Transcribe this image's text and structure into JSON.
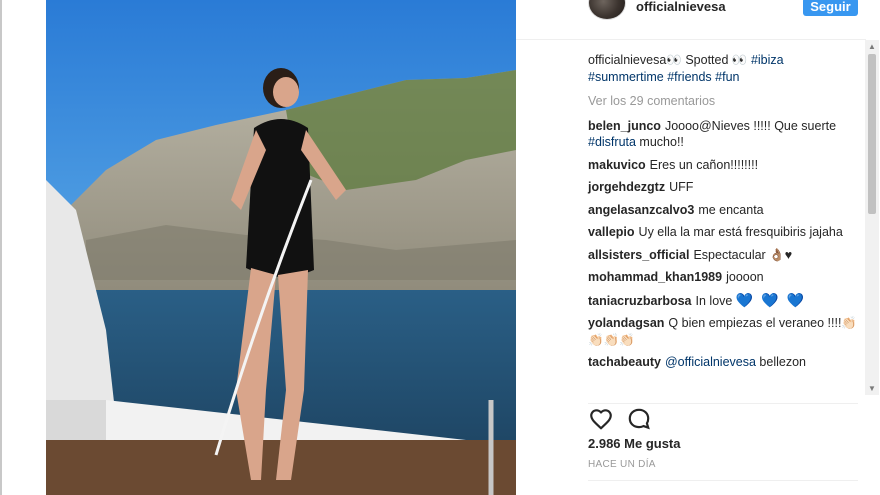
{
  "post": {
    "username": "officialnievesa",
    "follow_label": "Seguir"
  },
  "caption": {
    "user": "officialnievesa",
    "text_before": "👀 Spotted 👀 ",
    "tag1": "#ibiza",
    "tag2": "#summertime",
    "tag3": "#friends",
    "tag4": "#fun"
  },
  "view_all": "Ver los 29 comentarios",
  "comments": [
    {
      "user": "belen_junco",
      "text": "Joooo@Nieves !!!!! Que suerte ",
      "tag": "#disfruta",
      "after": " mucho!!"
    },
    {
      "user": "makuvico",
      "text": "Eres un cañon!!!!!!!!"
    },
    {
      "user": "jorgehdezgtz",
      "text": "UFF"
    },
    {
      "user": "angelasanzcalvo3",
      "text": "me encanta"
    },
    {
      "user": "vallepio",
      "text": "Uy ella la mar está fresquibiris jajaha"
    },
    {
      "user": "allsisters_official",
      "text": "Espectacular 👌🏽♥"
    },
    {
      "user": "mohammad_khan1989",
      "text": "joooon"
    },
    {
      "user": "taniacruzbarbosa",
      "text": "In love",
      "hearts": "💙 💙 💙"
    },
    {
      "user": "yolandagsan",
      "text": "Q bien empiezas el veraneo !!!!👏🏻👏🏻👏🏻👏🏻"
    },
    {
      "user": "tachabeauty",
      "mention": "@officialnievesa",
      "after": " bellezon"
    }
  ],
  "likes": "2.986 Me gusta",
  "timestamp": "HACE UN DÍA",
  "icons": [
    "heart-icon",
    "comment-icon"
  ]
}
